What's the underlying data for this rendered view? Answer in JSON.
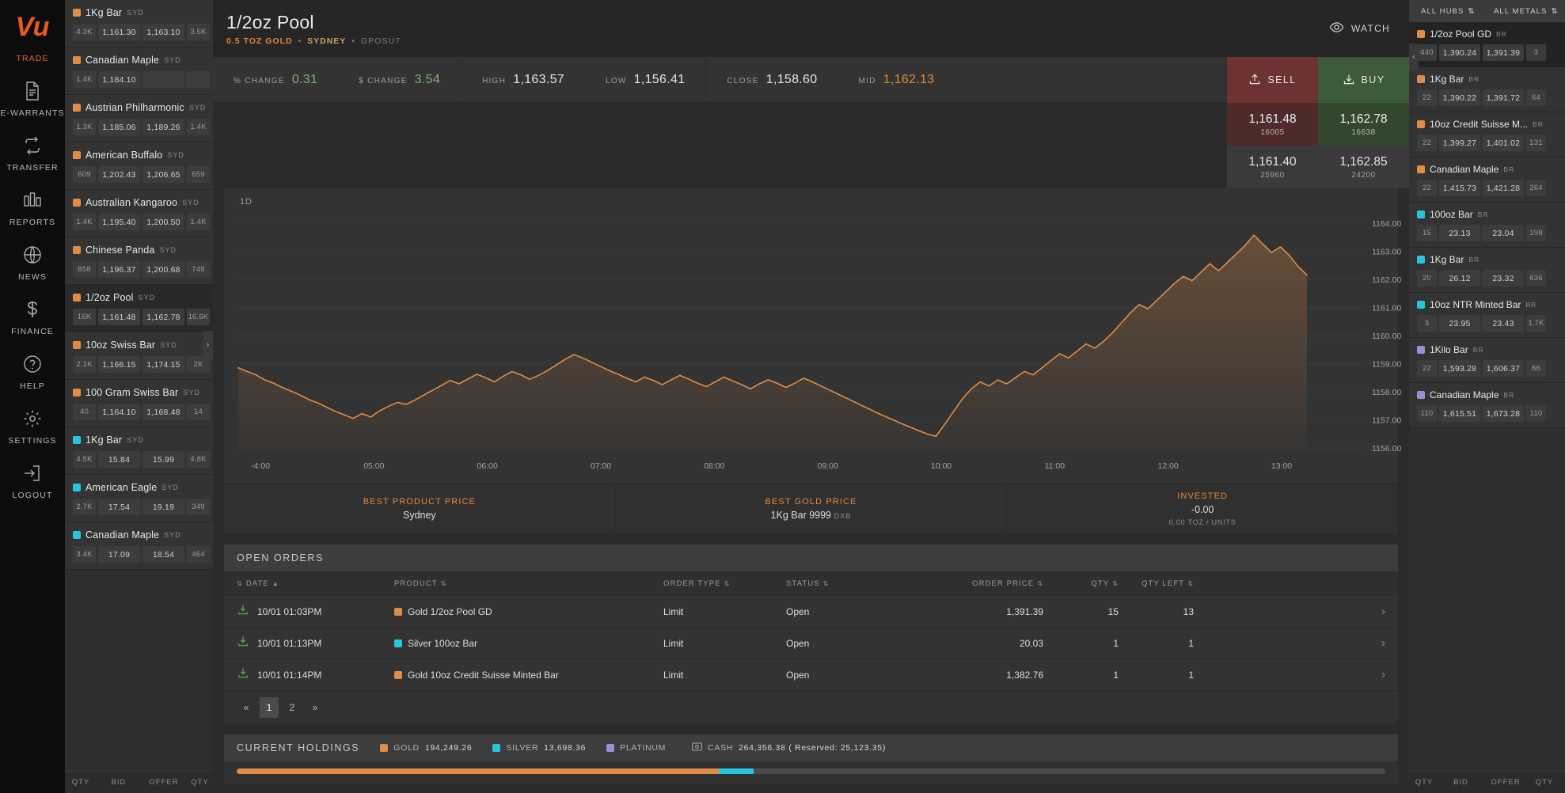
{
  "nav": {
    "logo_text": "Vu",
    "items": [
      {
        "label": "TRADE",
        "icon": "logo-icon",
        "active": true
      },
      {
        "label": "E-WARRANTS",
        "icon": "document-icon",
        "active": false
      },
      {
        "label": "TRANSFER",
        "icon": "transfer-icon",
        "active": false
      },
      {
        "label": "REPORTS",
        "icon": "bar-chart-icon",
        "active": false
      },
      {
        "label": "NEWS",
        "icon": "globe-icon",
        "active": false
      },
      {
        "label": "FINANCE",
        "icon": "dollar-icon",
        "active": false
      },
      {
        "label": "HELP",
        "icon": "question-circle-icon",
        "active": false
      },
      {
        "label": "SETTINGS",
        "icon": "gear-icon",
        "active": false
      },
      {
        "label": "LOGOUT",
        "icon": "logout-icon",
        "active": false
      }
    ]
  },
  "product_list": {
    "footer": [
      "QTY",
      "BID",
      "OFFER",
      "QTY"
    ],
    "collapse_icon": "chevron-right-icon",
    "rows": [
      {
        "name": "1Kg Bar",
        "hub": "SYD",
        "color": "#e08c46",
        "qty": "4.3K",
        "bid": "1,161.30",
        "offer": "1,163.10",
        "qty2": "3.5K",
        "selected": false
      },
      {
        "name": "Canadian Maple",
        "hub": "SYD",
        "color": "#e08c46",
        "qty": "1.4K",
        "bid": "1,184.10",
        "offer": "",
        "qty2": "",
        "selected": false
      },
      {
        "name": "Austrian Philharmonic",
        "hub": "SYD",
        "color": "#e08c46",
        "qty": "1.3K",
        "bid": "1,185.06",
        "offer": "1,189.26",
        "qty2": "1.4K",
        "selected": false
      },
      {
        "name": "American Buffalo",
        "hub": "SYD",
        "color": "#e08c46",
        "qty": "609",
        "bid": "1,202.43",
        "offer": "1,206.65",
        "qty2": "659",
        "selected": false
      },
      {
        "name": "Australian Kangaroo",
        "hub": "SYD",
        "color": "#e08c46",
        "qty": "1.4K",
        "bid": "1,195.40",
        "offer": "1,200.50",
        "qty2": "1.4K",
        "selected": false
      },
      {
        "name": "Chinese Panda",
        "hub": "SYD",
        "color": "#e08c46",
        "qty": "858",
        "bid": "1,196.37",
        "offer": "1,200.68",
        "qty2": "748",
        "selected": false
      },
      {
        "name": "1/2oz Pool",
        "hub": "SYD",
        "color": "#e08c46",
        "qty": "16K",
        "bid": "1,161.48",
        "offer": "1,162.78",
        "qty2": "16.6K",
        "selected": true
      },
      {
        "name": "10oz Swiss Bar",
        "hub": "SYD",
        "color": "#e08c46",
        "qty": "2.1K",
        "bid": "1,166.15",
        "offer": "1,174.15",
        "qty2": "2K",
        "selected": false
      },
      {
        "name": "100 Gram Swiss Bar",
        "hub": "SYD",
        "color": "#e08c46",
        "qty": "40",
        "bid": "1,164.10",
        "offer": "1,168.48",
        "qty2": "14",
        "selected": false
      },
      {
        "name": "1Kg Bar",
        "hub": "SYD",
        "color": "#27c4de",
        "qty": "4.5K",
        "bid": "15.84",
        "offer": "15.99",
        "qty2": "4.8K",
        "selected": false
      },
      {
        "name": "American Eagle",
        "hub": "SYD",
        "color": "#27c4de",
        "qty": "2.7K",
        "bid": "17.54",
        "offer": "19.19",
        "qty2": "349",
        "selected": false
      },
      {
        "name": "Canadian Maple",
        "hub": "SYD",
        "color": "#27c4de",
        "qty": "3.4K",
        "bid": "17.09",
        "offer": "18.54",
        "qty2": "464",
        "selected": false
      }
    ]
  },
  "header": {
    "title": "1/2oz Pool",
    "spec": "0.5 TOZ GOLD",
    "hub": "SYDNEY",
    "code": "GPOSU7",
    "watch_label": "WATCH",
    "watch_icon": "eye-icon",
    "quotes": [
      {
        "label": "% CHANGE",
        "value": "0.31",
        "style": "green"
      },
      {
        "label": "$ CHANGE",
        "value": "3.54",
        "style": "green"
      },
      {
        "label": "HIGH",
        "value": "1,163.57",
        "style": "plain"
      },
      {
        "label": "LOW",
        "value": "1,156.41",
        "style": "plain"
      },
      {
        "label": "CLOSE",
        "value": "1,158.60",
        "style": "plain"
      },
      {
        "label": "MID",
        "value": "1,162.13",
        "style": "orange"
      }
    ]
  },
  "trade": {
    "sell_label": "SELL",
    "buy_label": "BUY",
    "sell_icon": "upload-icon",
    "buy_icon": "download-icon",
    "sell_price": "1,161.48",
    "sell_qty": "16005",
    "buy_price": "1,162.78",
    "buy_qty": "16638",
    "sell_price2": "1,161.40",
    "sell_qty2": "25960",
    "buy_price2": "1,162.85",
    "buy_qty2": "24200"
  },
  "chart_data": {
    "type": "line",
    "title": "1/2oz Pool",
    "range_label": "1D",
    "xlabel": "",
    "ylabel": "",
    "grid": true,
    "legend": "none",
    "line_color": "#e08c46",
    "ylim": [
      1156.0,
      1164.5
    ],
    "yticks": [
      "1164.00",
      "1163.00",
      "1162.00",
      "1161.00",
      "1160.00",
      "1159.00",
      "1158.00",
      "1157.00",
      "1156.00"
    ],
    "xticks": [
      "-4:00",
      "05:00",
      "06:00",
      "07:00",
      "08:00",
      "09:00",
      "10:00",
      "11:00",
      "12:00",
      "13:00"
    ],
    "x": [
      0,
      1,
      2,
      3,
      4,
      5,
      6,
      7,
      8,
      9,
      10,
      11,
      12,
      13,
      14,
      15,
      16,
      17,
      18,
      19,
      20,
      21,
      22,
      23,
      24,
      25,
      26,
      27,
      28,
      29,
      30,
      31,
      32,
      33,
      34,
      35,
      36,
      37,
      38,
      39,
      40,
      41,
      42,
      43,
      44,
      45,
      46,
      47,
      48,
      49,
      50,
      51,
      52,
      53,
      54,
      55,
      56,
      57,
      58,
      59,
      60,
      61,
      62,
      63,
      64,
      65,
      66,
      67,
      68,
      69,
      70,
      71,
      72,
      73,
      74,
      75,
      76,
      77,
      78,
      79,
      80,
      81,
      82,
      83,
      84,
      85,
      86,
      87,
      88,
      89,
      90,
      91,
      92,
      93,
      94,
      95,
      96,
      97,
      98,
      99,
      100,
      101,
      102,
      103,
      104,
      105,
      106,
      107,
      108,
      109,
      110,
      111,
      112,
      113,
      114,
      115,
      116,
      117,
      118,
      119
    ],
    "values": [
      1158.85,
      1158.72,
      1158.6,
      1158.42,
      1158.3,
      1158.15,
      1158.02,
      1157.88,
      1157.72,
      1157.6,
      1157.45,
      1157.3,
      1157.18,
      1157.05,
      1157.22,
      1157.1,
      1157.32,
      1157.48,
      1157.62,
      1157.55,
      1157.7,
      1157.88,
      1158.05,
      1158.22,
      1158.4,
      1158.28,
      1158.45,
      1158.62,
      1158.5,
      1158.35,
      1158.55,
      1158.72,
      1158.6,
      1158.44,
      1158.58,
      1158.75,
      1158.95,
      1159.15,
      1159.32,
      1159.2,
      1159.05,
      1158.9,
      1158.75,
      1158.62,
      1158.48,
      1158.35,
      1158.52,
      1158.4,
      1158.25,
      1158.42,
      1158.58,
      1158.45,
      1158.3,
      1158.18,
      1158.35,
      1158.52,
      1158.38,
      1158.25,
      1158.1,
      1158.28,
      1158.42,
      1158.3,
      1158.15,
      1158.3,
      1158.48,
      1158.35,
      1158.2,
      1158.05,
      1157.9,
      1157.75,
      1157.6,
      1157.45,
      1157.3,
      1157.15,
      1157.02,
      1156.88,
      1156.75,
      1156.62,
      1156.5,
      1156.41,
      1156.85,
      1157.3,
      1157.75,
      1158.1,
      1158.35,
      1158.2,
      1158.42,
      1158.28,
      1158.5,
      1158.72,
      1158.6,
      1158.85,
      1159.1,
      1159.35,
      1159.2,
      1159.45,
      1159.7,
      1159.55,
      1159.8,
      1160.1,
      1160.45,
      1160.8,
      1161.1,
      1160.95,
      1161.25,
      1161.55,
      1161.85,
      1162.1,
      1161.95,
      1162.25,
      1162.55,
      1162.3,
      1162.6,
      1162.9,
      1163.2,
      1163.57,
      1163.25,
      1162.95,
      1163.15,
      1162.85,
      1162.45,
      1162.15
    ]
  },
  "best_bar": [
    {
      "title": "BEST PRODUCT PRICE",
      "value": "Sydney",
      "tag": "",
      "sub": ""
    },
    {
      "title": "BEST GOLD PRICE",
      "value": "1Kg Bar 9999",
      "tag": "DXB",
      "sub": ""
    },
    {
      "title": "INVESTED",
      "value": "-0.00",
      "tag": "",
      "sub": "0.00 TOZ / UNITS"
    }
  ],
  "open_orders": {
    "panel_title": "OPEN ORDERS",
    "columns": [
      "DATE",
      "PRODUCT",
      "ORDER TYPE",
      "STATUS",
      "ORDER PRICE",
      "QTY",
      "QTY LEFT"
    ],
    "rows": [
      {
        "date": "10/01 01:03PM",
        "product": "Gold 1/2oz Pool GD",
        "color": "#e08c46",
        "type": "Limit",
        "status": "Open",
        "price": "1,391.39",
        "qty": "15",
        "qty_left": "13",
        "icon": "download-icon"
      },
      {
        "date": "10/01 01:13PM",
        "product": "Silver 100oz Bar",
        "color": "#27c4de",
        "type": "Limit",
        "status": "Open",
        "price": "20.03",
        "qty": "1",
        "qty_left": "1",
        "icon": "download-icon"
      },
      {
        "date": "10/01 01:14PM",
        "product": "Gold 10oz Credit Suisse Minted Bar",
        "color": "#e08c46",
        "type": "Limit",
        "status": "Open",
        "price": "1,382.76",
        "qty": "1",
        "qty_left": "1",
        "icon": "download-icon"
      }
    ],
    "pagination": [
      "«",
      "1",
      "2",
      "»"
    ],
    "current_page": "1"
  },
  "holdings": {
    "panel_title": "CURRENT HOLDINGS",
    "chips": [
      {
        "label": "GOLD",
        "value": "194,249.26",
        "color": "#e08c46"
      },
      {
        "label": "SILVER",
        "value": "13,698.36",
        "color": "#27c4de"
      },
      {
        "label": "PLATINUM",
        "value": "",
        "color": "#9a8ed6"
      },
      {
        "label": "CASH",
        "value": "264,356.38 ( Reserved: 25,123.35)",
        "color": "#8f8f8f"
      }
    ],
    "bar_segments": [
      {
        "color": "#e08c46",
        "pct": 42
      },
      {
        "color": "#27c4de",
        "pct": 3
      },
      {
        "color": "#4a4a4a",
        "pct": 55
      }
    ]
  },
  "right_sidebar": {
    "filters": [
      {
        "label": "ALL HUBS",
        "icon": "chevron-updown-icon"
      },
      {
        "label": "ALL METALS",
        "icon": "chevron-updown-icon"
      }
    ],
    "footer": [
      "QTY",
      "BID",
      "OFFER",
      "QTY"
    ],
    "collapse_icon": "chevron-left-icon",
    "rows": [
      {
        "name": "1/2oz Pool GD",
        "hub": "BR",
        "color": "#e08c46",
        "qty": "440",
        "bid": "1,390.24",
        "offer": "1,391.39",
        "qty2": "3",
        "selected": true
      },
      {
        "name": "1Kg Bar",
        "hub": "BR",
        "color": "#e08c46",
        "qty": "22",
        "bid": "1,390.22",
        "offer": "1,391.72",
        "qty2": "64",
        "selected": false
      },
      {
        "name": "10oz Credit Suisse M...",
        "hub": "BR",
        "color": "#e08c46",
        "qty": "22",
        "bid": "1,399.27",
        "offer": "1,401.02",
        "qty2": "131",
        "selected": false
      },
      {
        "name": "Canadian Maple",
        "hub": "BR",
        "color": "#e08c46",
        "qty": "22",
        "bid": "1,415.73",
        "offer": "1,421.28",
        "qty2": "264",
        "selected": false
      },
      {
        "name": "100oz Bar",
        "hub": "BR",
        "color": "#27c4de",
        "qty": "15",
        "bid": "23.13",
        "offer": "23.04",
        "qty2": "198",
        "selected": false
      },
      {
        "name": "1Kg Bar",
        "hub": "BR",
        "color": "#27c4de",
        "qty": "20",
        "bid": "26.12",
        "offer": "23.32",
        "qty2": "636",
        "selected": false
      },
      {
        "name": "10oz NTR Minted Bar",
        "hub": "BR",
        "color": "#27c4de",
        "qty": "3",
        "bid": "23.95",
        "offer": "23.43",
        "qty2": "1.7K",
        "selected": false
      },
      {
        "name": "1Kilo Bar",
        "hub": "BR",
        "color": "#9a8ed6",
        "qty": "22",
        "bid": "1,593.28",
        "offer": "1,606.37",
        "qty2": "66",
        "selected": false
      },
      {
        "name": "Canadian Maple",
        "hub": "BR",
        "color": "#9a8ed6",
        "qty": "110",
        "bid": "1,615.51",
        "offer": "1,673.28",
        "qty2": "110",
        "selected": false
      }
    ]
  }
}
